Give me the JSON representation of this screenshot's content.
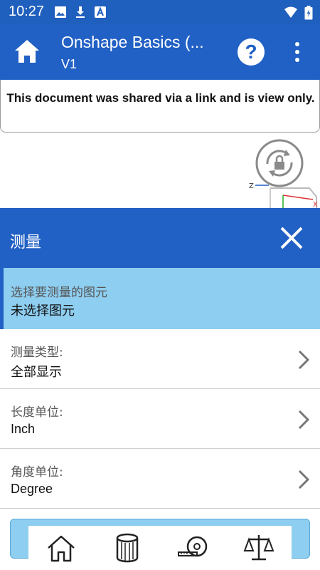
{
  "status_bar": {
    "time": "10:27"
  },
  "app_bar": {
    "title": "Onshape Basics (...",
    "subtitle": "V1",
    "help_label": "?"
  },
  "banner": {
    "text": "This document was shared via a link and is view only."
  },
  "panel": {
    "title": "测量",
    "selection": {
      "label": "选择要测量的图元",
      "value": "未选择图元"
    },
    "options": [
      {
        "label": "测量类型:",
        "value": "全部显示"
      },
      {
        "label": "长度单位:",
        "value": "Inch"
      },
      {
        "label": "角度单位:",
        "value": "Degree"
      }
    ]
  },
  "colors": {
    "primary": "#2160c4",
    "status": "#1f5fbd",
    "highlight": "#8ecef0"
  },
  "icons": {
    "status": [
      "image-icon",
      "download-icon",
      "font-icon",
      "wifi-icon",
      "battery-icon"
    ],
    "nav": [
      "home-icon",
      "mass-properties-icon",
      "measure-tape-icon",
      "balance-scale-icon"
    ]
  }
}
